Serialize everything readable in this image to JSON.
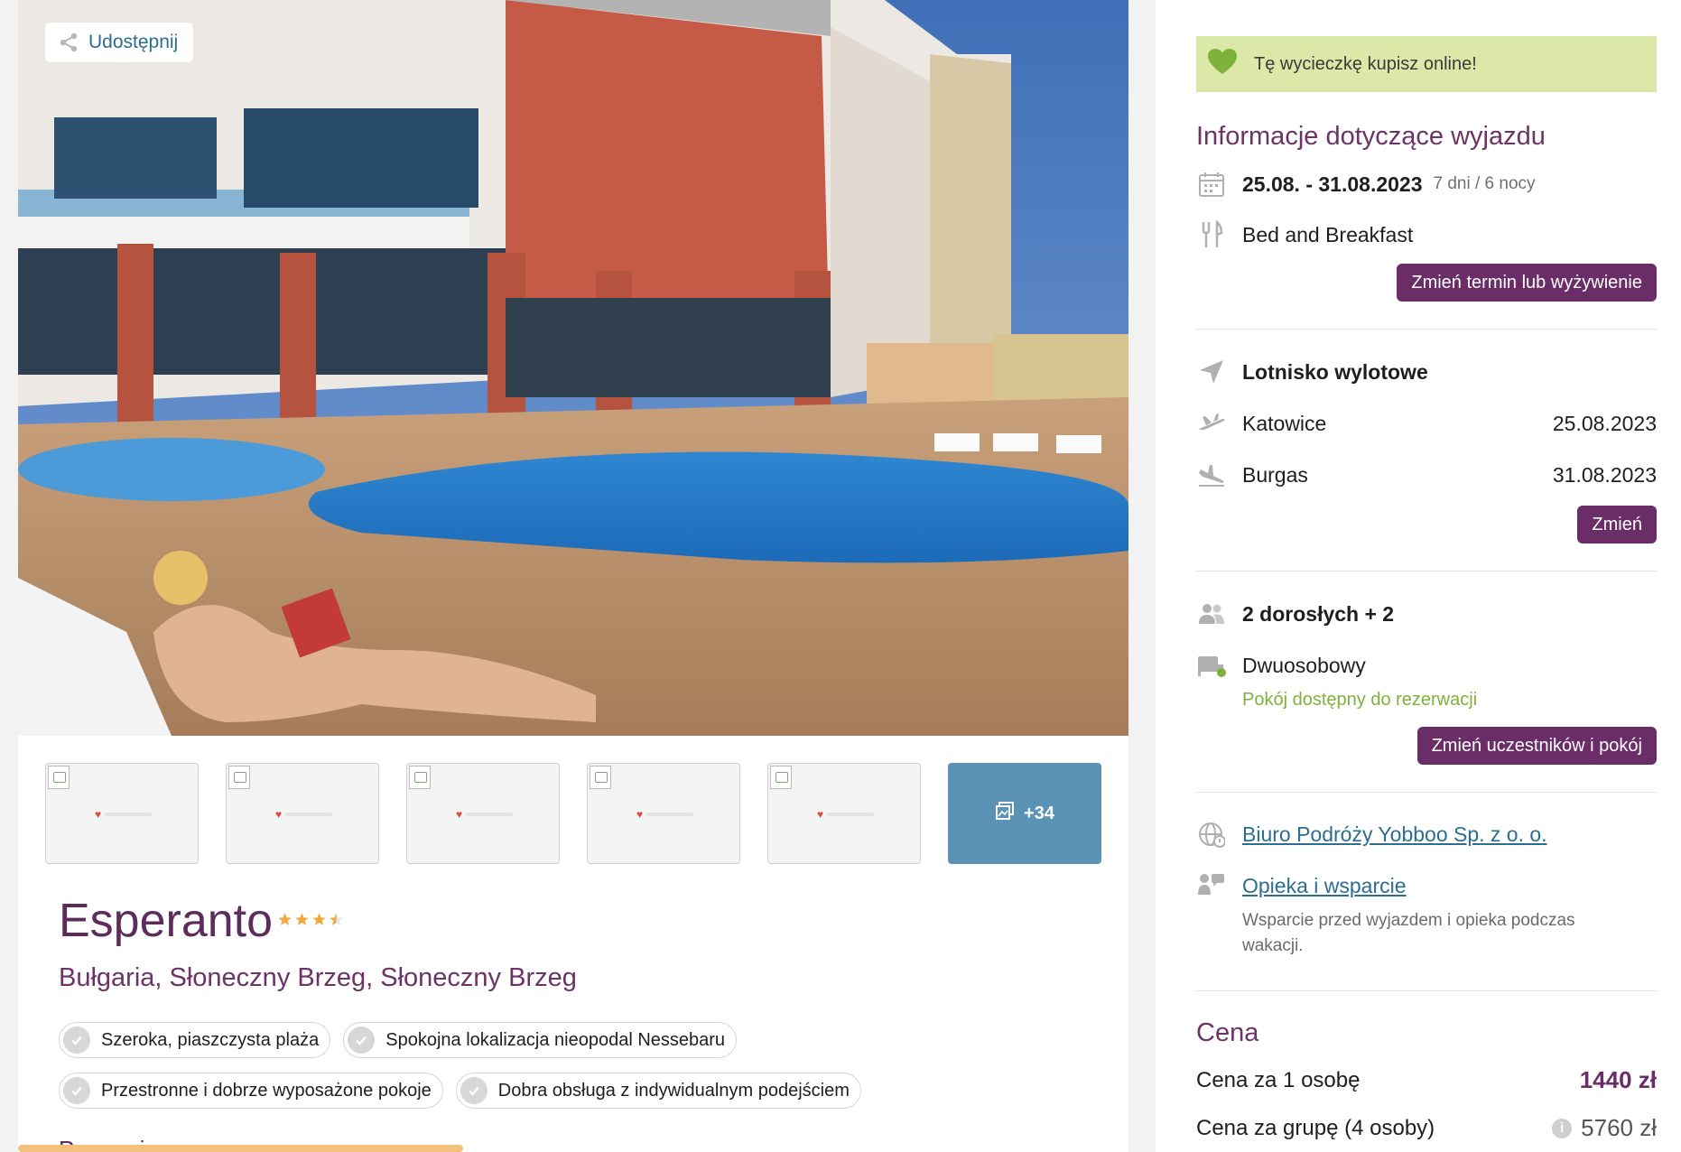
{
  "hero": {
    "share_label": "Udostępnij",
    "more_photos_label": "+34"
  },
  "hotel": {
    "name": "Esperanto",
    "stars": 3.5,
    "location": "Bułgaria, Słoneczny Brzeg, Słoneczny Brzeg",
    "features": [
      "Szeroka, piaszczysta plaża",
      "Spokojna lokalizacja nieopodal Nessebaru",
      "Przestronne i dobrze wyposażone pokoje",
      "Dobra obsługa z indywidualnym podejściem"
    ],
    "promo_heading": "Promocja"
  },
  "sidebar": {
    "online_banner": "Tę wycieczkę kupisz online!",
    "trip_info_title": "Informacje dotyczące wyjazdu",
    "dates": "25.08. - 31.08.2023",
    "duration": "7 dni / 6 nocy",
    "board": "Bed and Breakfast",
    "change_term_button": "Zmień termin lub wyżywienie",
    "airport_heading": "Lotnisko wylotowe",
    "departure_city": "Katowice",
    "departure_date": "25.08.2023",
    "arrival_city": "Burgas",
    "arrival_date": "31.08.2023",
    "change_flight_button": "Zmień",
    "participants": "2 dorosłych + 2",
    "room_type": "Dwuosobowy",
    "room_availability": "Pokój dostępny do rezerwacji",
    "change_participants_button": "Zmień uczestników i pokój",
    "agency_link": "Biuro Podróży Yobboo Sp. z o. o.",
    "support_link": "Opieka i wsparcie",
    "support_description": "Wsparcie przed wyjazdem i opieka podczas wakacji.",
    "price_title": "Cena",
    "price_per_person_label": "Cena za 1 osobę",
    "price_per_person_value": "1440 zł",
    "price_group_label": "Cena za grupę (4 osoby)",
    "price_group_value": "5760 zł"
  },
  "colors": {
    "brand_purple": "#6b2d68",
    "title_purple": "#5d2c5a",
    "link_blue": "#2c6e8f",
    "banner_green": "#dbe8a7",
    "heart_green": "#7fb23a",
    "thumb_more_blue": "#5a93b5"
  },
  "icons": {
    "share": "share-icon",
    "heart": "heart-icon",
    "calendar": "calendar-icon",
    "cutlery": "cutlery-icon",
    "plane_navigation": "navigation-arrow-icon",
    "takeoff": "plane-takeoff-icon",
    "landing": "plane-landing-icon",
    "people": "people-icon",
    "bed": "bed-icon",
    "globe_agency": "globe-icon",
    "support": "support-icon",
    "gallery": "gallery-icon",
    "check": "check-icon",
    "star": "star-icon",
    "info": "info-icon"
  }
}
